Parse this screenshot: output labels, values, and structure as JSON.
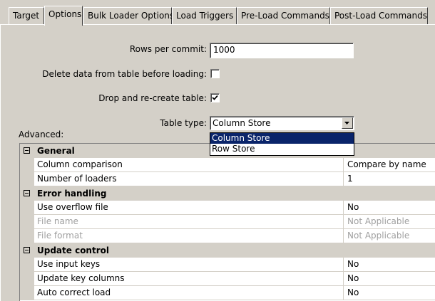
{
  "tabs": [
    {
      "label": "Target"
    },
    {
      "label": "Options",
      "active": true
    },
    {
      "label": "Bulk Loader Options"
    },
    {
      "label": "Load Triggers"
    },
    {
      "label": "Pre-Load Commands"
    },
    {
      "label": "Post-Load Commands"
    }
  ],
  "form": {
    "rows_per_commit_label": "Rows per commit:",
    "rows_per_commit_value": "1000",
    "delete_data_label": "Delete data from table before loading:",
    "delete_data_checked": false,
    "drop_recreate_label": "Drop and re-create table:",
    "drop_recreate_checked": true,
    "table_type_label": "Table type:",
    "table_type_value": "Column Store",
    "table_type_options": [
      "Column Store",
      "Row Store"
    ]
  },
  "advanced": {
    "label": "Advanced:",
    "groups": [
      {
        "title": "General",
        "rows": [
          {
            "name": "Column comparison",
            "value": "Compare by name"
          },
          {
            "name": "Number of loaders",
            "value": "1"
          }
        ]
      },
      {
        "title": "Error handling",
        "rows": [
          {
            "name": "Use overflow file",
            "value": "No"
          },
          {
            "name": "File name",
            "value": "Not Applicable",
            "disabled": true
          },
          {
            "name": "File format",
            "value": "Not Applicable",
            "disabled": true
          }
        ]
      },
      {
        "title": "Update control",
        "rows": [
          {
            "name": "Use input keys",
            "value": "No"
          },
          {
            "name": "Update key columns",
            "value": "No"
          },
          {
            "name": "Auto correct load",
            "value": "No"
          }
        ]
      }
    ]
  },
  "colors": {
    "background": "#d4d0c8",
    "selection": "#0a246a",
    "disabled_text": "#a0a0a0"
  }
}
